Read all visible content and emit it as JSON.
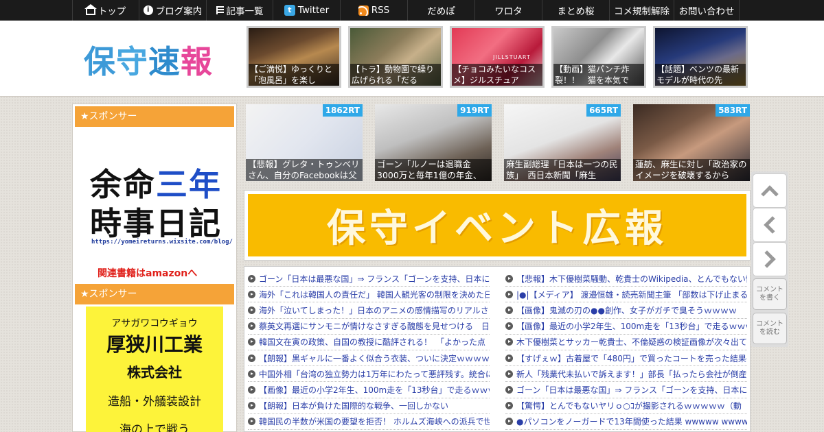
{
  "nav": {
    "items": [
      {
        "label": "トップ",
        "icon": "home-icon",
        "w": 97
      },
      {
        "label": "ブログ案内",
        "icon": "info-icon",
        "w": 98
      },
      {
        "label": "記事一覧",
        "icon": "list-icon",
        "w": 97
      },
      {
        "label": "Twitter",
        "icon": "twitter-icon",
        "w": 98
      },
      {
        "label": "RSS",
        "icon": "rss-icon",
        "w": 98
      },
      {
        "label": "だめぽ",
        "icon": "",
        "w": 98
      },
      {
        "label": "ワロタ",
        "icon": "",
        "w": 98
      },
      {
        "label": "まとめ桜",
        "icon": "",
        "w": 98
      },
      {
        "label": "コメ規制解除",
        "icon": "",
        "w": 94
      },
      {
        "label": "お問い合わせ",
        "icon": "",
        "w": 96
      }
    ]
  },
  "header": {
    "logo": {
      "c1": "保",
      "c2": "守",
      "c3": "速",
      "c4": "報"
    },
    "thumbs": [
      {
        "caption": "【ご満悦】ゆっくりと「泡風呂」を楽し",
        "bg": "linear-gradient(160deg,#2a1d14 0%,#6b4a2e 35%,#b7894f 55%,#3b2d23 100%)"
      },
      {
        "caption": "【トラ】動物園で繰り広げられる「だる",
        "bg": "linear-gradient(140deg,#4a5a38 0%,#8b7c5a 40%,#c7b08a 60%,#5a6444 100%)"
      },
      {
        "caption": "【チョコみたいなコスメ】ジルスチュア",
        "bg": "linear-gradient(135deg,#e23a55 0%,#f26e82 40%,#b81a3a 70%,#e9c4c8 100%)",
        "overlay": "JILLSTUART"
      },
      {
        "caption": "【動画】猫パンチ炸裂！！　猫を本気で",
        "bg": "linear-gradient(135deg,#c9c9c9 0%,#8e8e8e 40%,#e8e8e8 60%,#555 100%)"
      },
      {
        "caption": "【話題】ベンツの最新モデルが時代の先",
        "bg": "linear-gradient(160deg,#0e1530 0%,#263a7a 40%,#6a6a8a 60%,#a7842f 100%)"
      }
    ]
  },
  "sidebar": {
    "sponsor_label_1": "★スポンサー",
    "sponsor_label_2": "★スポンサー",
    "ad1": {
      "line1a": "余命",
      "line1b": "三年",
      "line2": "時事日記",
      "url": "https://yomeireturns.wixsite.com/blog/",
      "amazon": "関連書籍はamazonへ"
    },
    "ad2": {
      "kana": "アサガワコウギョウ",
      "name": "厚狭川工業",
      "company": "株式会社",
      "desc": "造船・外艤装設計",
      "more": "海の上で戦う"
    }
  },
  "trending": [
    {
      "caption": "【悲報】グレタ・トゥンベリさん、自分のFacebookは父",
      "rt": "1862RT",
      "bg": "linear-gradient(135deg,#f3f3f3 0%,#e2e6ef 50%,#c7d0e0 100%)"
    },
    {
      "caption": "ゴーン「ルノーは退職金3000万と毎年1億の年金、",
      "rt": "919RT",
      "bg": "linear-gradient(160deg,#e8e8e8 0%,#bfbfbf 40%,#6e6257 70%,#2b2622 100%)"
    },
    {
      "caption": "麻生副総理「日本は一つの民族」　西日本新聞「麻生",
      "rt": "665RT",
      "bg": "linear-gradient(160deg,#f6f6f6 0%,#e4e4e4 45%,#a0837a 70%,#3d3a56 100%)"
    },
    {
      "caption": "蓮舫、麻生に対し「政治家のイメージを破壊するから",
      "rt": "583RT",
      "bg": "linear-gradient(150deg,#3a2a22 0%,#7a5a46 35%,#c79a7e 55%,#2a2a34 100%)"
    }
  ],
  "banner": {
    "text": "保守イベント広報"
  },
  "articles": {
    "left": [
      "ゴーン「日本は最悪な国」⇒ フランス「ゴーンを支持、日本に",
      "海外「これは韓国人の責任だ」 韓国人観光客の制限を決めた日",
      "海外「泣いてしまった！」日本のアニメの感情描写のリアルさ",
      "蔡英文再選にサンモニが情けなさすぎる醜態を見せつける　日",
      "韓国文在寅の政策、自国の教授に酷評される！　「よかった点",
      "【朗報】黒ギャルに一番よく似合う衣装、ついに決定ｗｗｗｗ",
      "中国外相「台湾の独立勢力は1万年にわたって悪評残す。統合に",
      "【画像】最近の小学2年生、100m走を「13秒台」で走るｗｗｗ",
      "【朗報】日本が負けた国際的な戦争、一回しかない",
      "韓国民の半数が米国の要望を拒否！ ホルムズ海峡への派兵で世"
    ],
    "right": [
      "【悲報】木下優樹菜騒動、乾貴士のWikipedia、とんでもない情",
      "|●|【メディア】 渡邉恒雄・読売新聞主筆 「部数は下げ止まる。",
      "【画像】鬼滅の刃の●●創作、女子がガチで臭そうｗｗｗｗ",
      "【画像】最近の小学2年生、100m走を「13秒台」で走るｗｗｗ",
      "木下優樹菜とサッカー乾貴士、不倫疑惑の検証画像が次々出て",
      "【すげぇｗ】古着屋で「480円」で買ったコートを売った結果→",
      "新人「残業代未払いで訴えます！」部長「払ったら会社が倒産",
      "ゴーン「日本は最悪な国」⇒ フランス「ゴーンを支持、日本に",
      "【驚愕】とんでもないヤリｏ○ｺが撮影されるｗｗｗｗｗ（動",
      "●パソコンをノーガードで13年間使った結果 wwwww wwwww"
    ]
  },
  "float": {
    "comment_write": "コメントを書く",
    "comment_read": "コメントを読む"
  }
}
